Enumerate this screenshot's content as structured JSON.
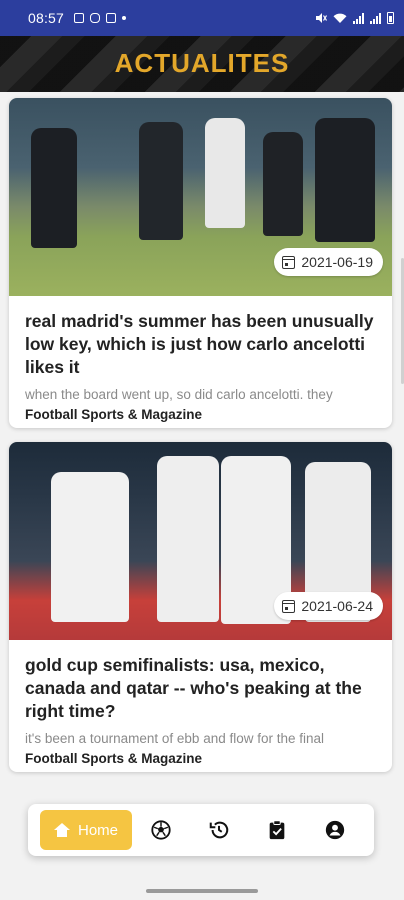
{
  "status_bar": {
    "time": "08:57"
  },
  "header": {
    "title": "ACTUALITES",
    "title_color": "#e3a72a"
  },
  "articles": [
    {
      "date": "2021-06-19",
      "title": "real madrid's summer has been unusually low key, which is just how carlo ancelotti likes it",
      "excerpt": "when the board went up, so did carlo ancelotti. they",
      "source": "Football Sports & Magazine"
    },
    {
      "date": "2021-06-24",
      "title": "gold cup semifinalists: usa, mexico, canada and qatar -- who's peaking at the right time?",
      "excerpt": "it's been a tournament of ebb and flow for the final",
      "source": "Football Sports & Magazine"
    }
  ],
  "bottom_nav": {
    "home_label": "Home",
    "active_color": "#f5c542",
    "items": [
      "home-icon",
      "soccer-ball-icon",
      "history-icon",
      "clipboard-check-icon",
      "account-icon"
    ]
  }
}
